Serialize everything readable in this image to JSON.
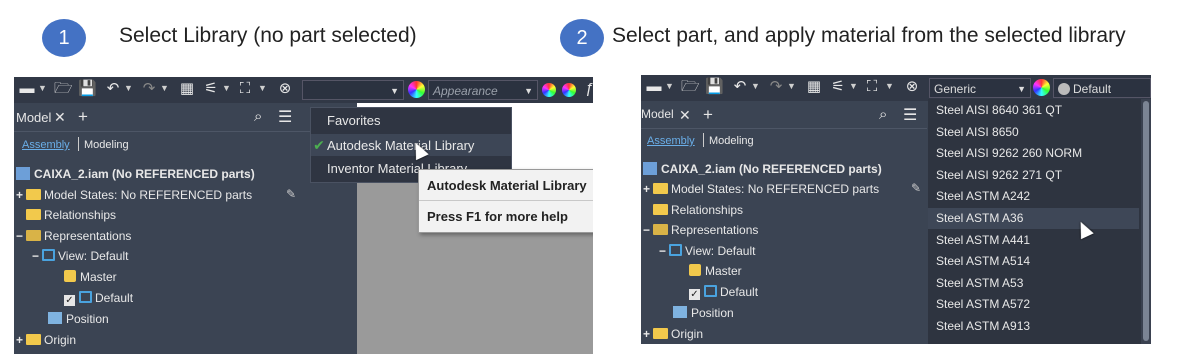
{
  "steps": [
    {
      "number": "1",
      "text": "Select Library (no part selected)"
    },
    {
      "number": "2",
      "text": "Select part, and apply material from the selected library"
    }
  ],
  "left": {
    "appearance_placeholder": "Appearance",
    "model_tab": "Model",
    "close": "✕",
    "add": "+",
    "assembly_tab": "Assembly",
    "modeling_tab": "Modeling",
    "tree": {
      "root": "CAIXA_2.iam (No REFERENCED parts)",
      "model_states": "Model States: No REFERENCED parts",
      "relationships": "Relationships",
      "representations": "Representations",
      "view_default": "View: Default",
      "master": "Master",
      "default": "Default",
      "position": "Position",
      "origin": "Origin"
    },
    "library_menu": [
      "Favorites",
      "Autodesk Material Library",
      "Inventor Material Library"
    ],
    "selected_library_check": "✔",
    "tooltip": {
      "title": "Autodesk Material Library",
      "help": "Press F1 for more help"
    }
  },
  "right": {
    "material_combo": "Generic",
    "appearance_combo": "Default",
    "model_tab": "Model",
    "close": "✕",
    "add": "+",
    "assembly_tab": "Assembly",
    "modeling_tab": "Modeling",
    "tree": {
      "root": "CAIXA_2.iam (No REFERENCED parts)",
      "model_states": "Model States: No REFERENCED parts",
      "relationships": "Relationships",
      "representations": "Representations",
      "view_default": "View: Default",
      "master": "Master",
      "default": "Default",
      "position": "Position",
      "origin": "Origin"
    },
    "materials": [
      "Steel AISI 8640 361 QT",
      "Steel AISI 8650",
      "Steel AISI 9262 260 NORM",
      "Steel AISI 9262 271 QT",
      "Steel ASTM A242",
      "Steel ASTM A36",
      "Steel ASTM A441",
      "Steel ASTM A514",
      "Steel ASTM A53",
      "Steel ASTM A572",
      "Steel ASTM A913"
    ],
    "highlighted_material_index": 5
  },
  "colors": {
    "step_blue": "#4472c4",
    "panel_bg": "#3b4453",
    "check_green": "#4caf50"
  }
}
